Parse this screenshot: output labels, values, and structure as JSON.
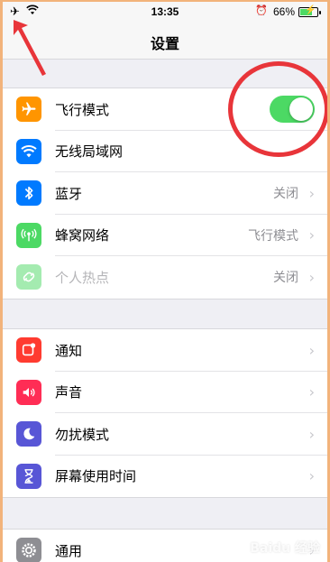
{
  "status_bar": {
    "time": "13:35",
    "battery": "66%"
  },
  "navbar": {
    "title": "设置"
  },
  "group1": [
    {
      "label": "飞行模式",
      "icon": "airplane-icon",
      "color": "#ff9500",
      "toggle": true
    },
    {
      "label": "无线局域网",
      "icon": "wifi-icon",
      "color": "#007aff",
      "value": ""
    },
    {
      "label": "蓝牙",
      "icon": "bluetooth-icon",
      "color": "#007aff",
      "value": "关闭"
    },
    {
      "label": "蜂窝网络",
      "icon": "cellular-icon",
      "color": "#4cd964",
      "value": "飞行模式"
    },
    {
      "label": "个人热点",
      "icon": "hotspot-icon",
      "color": "#4cd964",
      "value": "关闭",
      "disabled": true
    }
  ],
  "group2": [
    {
      "label": "通知",
      "icon": "notification-icon",
      "color": "#ff3b30"
    },
    {
      "label": "声音",
      "icon": "sound-icon",
      "color": "#ff2d55"
    },
    {
      "label": "勿扰模式",
      "icon": "moon-icon",
      "color": "#5856d6"
    },
    {
      "label": "屏幕使用时间",
      "icon": "hourglass-icon",
      "color": "#5856d6"
    }
  ],
  "group3": [
    {
      "label": "通用",
      "icon": "gear-icon",
      "color": "#8e8e93"
    }
  ],
  "watermark": "Baidu 经验"
}
